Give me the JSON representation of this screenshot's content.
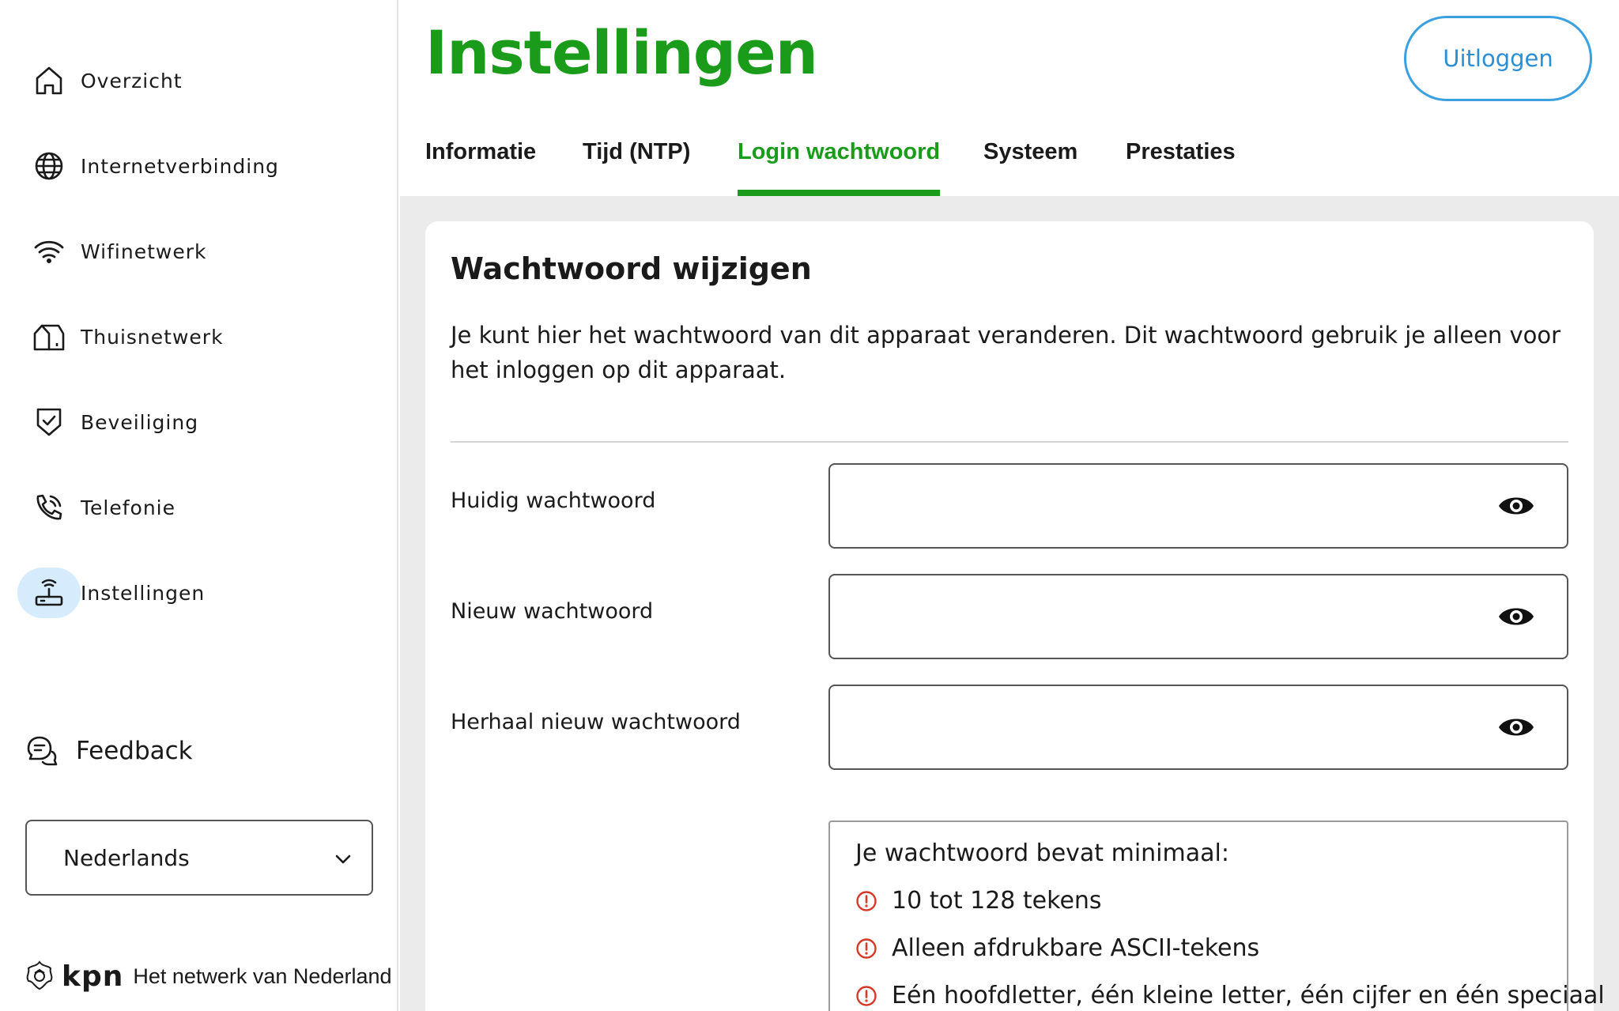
{
  "sidebar": {
    "items": [
      {
        "label": "Overzicht",
        "icon": "home-icon"
      },
      {
        "label": "Internetverbinding",
        "icon": "globe-icon"
      },
      {
        "label": "Wifinetwerk",
        "icon": "wifi-icon"
      },
      {
        "label": "Thuisnetwerk",
        "icon": "house-network-icon"
      },
      {
        "label": "Beveiliging",
        "icon": "shield-check-icon"
      },
      {
        "label": "Telefonie",
        "icon": "phone-icon"
      },
      {
        "label": "Instellingen",
        "icon": "router-icon",
        "active": true
      }
    ],
    "feedback_label": "Feedback",
    "language": {
      "selected": "Nederlands"
    },
    "brand": {
      "logo_text": "kpn",
      "tagline": "Het netwerk van Nederland"
    }
  },
  "header": {
    "title": "Instellingen",
    "logout_label": "Uitloggen",
    "tabs": [
      {
        "label": "Informatie"
      },
      {
        "label": "Tijd (NTP)"
      },
      {
        "label": "Login wachtwoord",
        "active": true
      },
      {
        "label": "Systeem"
      },
      {
        "label": "Prestaties"
      }
    ]
  },
  "card": {
    "title": "Wachtwoord wijzigen",
    "description": "Je kunt hier het wachtwoord van dit apparaat veranderen. Dit wachtwoord gebruik je alleen voor het inloggen op dit apparaat.",
    "fields": [
      {
        "label": "Huidig wachtwoord",
        "value": "",
        "placeholder": ""
      },
      {
        "label": "Nieuw wachtwoord",
        "value": "",
        "placeholder": ""
      },
      {
        "label": "Herhaal nieuw wachtwoord",
        "value": "",
        "placeholder": ""
      }
    ],
    "requirements": {
      "title": "Je wachtwoord bevat minimaal:",
      "items": [
        "10 tot 128 tekens",
        "Alleen afdrukbare ASCII-tekens",
        "Eén hoofdletter, één kleine letter, één cijfer en één speciaal"
      ]
    }
  },
  "colors": {
    "brand_green": "#1a9c1a",
    "link_blue": "#2b8fd6",
    "active_nav_bg": "#d6ebfb",
    "warning_red": "#d23a2a",
    "content_bg": "#ebebeb"
  }
}
